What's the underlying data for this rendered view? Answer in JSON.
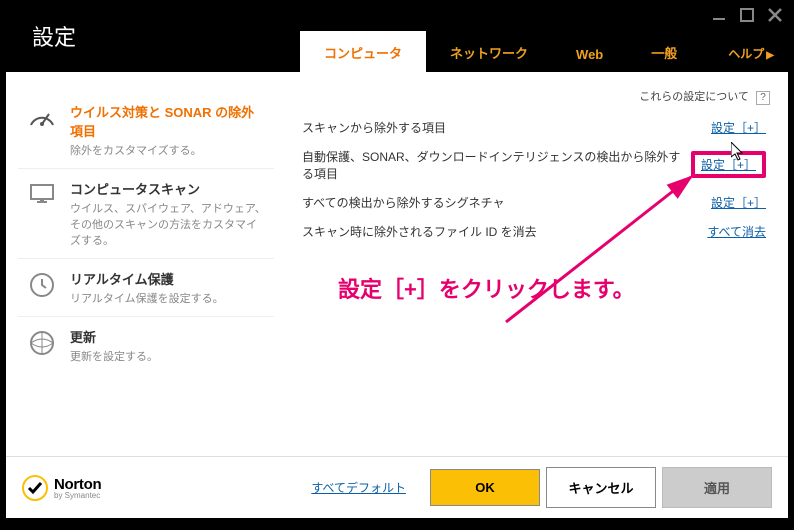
{
  "window": {
    "title": "設定"
  },
  "tabs": {
    "t0": "コンピュータ",
    "t1": "ネットワーク",
    "t2": "Web",
    "t3": "一般",
    "help": "ヘルプ"
  },
  "sidebar": {
    "items": [
      {
        "title": "ウイルス対策と SONAR の除外項目",
        "desc": "除外をカスタマイズする。"
      },
      {
        "title": "コンピュータスキャン",
        "desc": "ウイルス、スパイウェア、アドウェア、その他のスキャンの方法をカスタマイズする。"
      },
      {
        "title": "リアルタイム保護",
        "desc": "リアルタイム保護を設定する。"
      },
      {
        "title": "更新",
        "desc": "更新を設定する。"
      }
    ]
  },
  "about": {
    "label": "これらの設定について"
  },
  "settings": {
    "rows": [
      {
        "label": "スキャンから除外する項目",
        "action": "設定［+］"
      },
      {
        "label": "自動保護、SONAR、ダウンロードインテリジェンスの検出から除外する項目",
        "action": "設定［+］"
      },
      {
        "label": "すべての検出から除外するシグネチャ",
        "action": "設定［+］"
      },
      {
        "label": "スキャン時に除外されるファイル ID を消去",
        "action": "すべて消去"
      }
    ]
  },
  "annotation": "設定［+］をクリックします。",
  "footer": {
    "brand": "Norton",
    "sub": "by Symantec",
    "default": "すべてデフォルト",
    "ok": "OK",
    "cancel": "キャンセル",
    "apply": "適用"
  }
}
